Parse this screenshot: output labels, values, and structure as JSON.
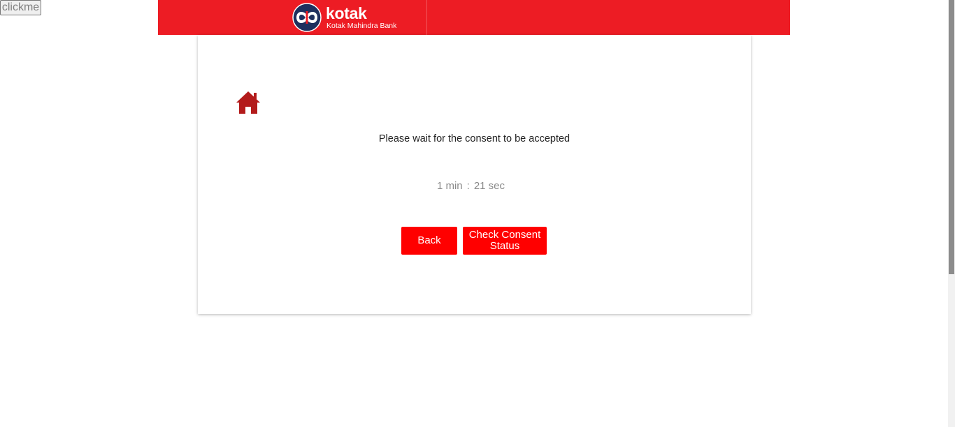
{
  "debug_button": {
    "label": "clickme"
  },
  "header": {
    "brand_name": "kotak",
    "brand_subtitle": "Kotak Mahindra Bank",
    "brand_color": "#ed1c24",
    "logo_icon": "kotak-infinity-logo"
  },
  "consent": {
    "home_icon": "home-icon",
    "message": "Please wait for the consent to be accepted",
    "timer": {
      "minutes": "1 min",
      "separator": ":",
      "seconds": "21 sec"
    },
    "back_label": "Back",
    "check_status_label": "Check Consent Status",
    "button_color": "#ff0000"
  }
}
